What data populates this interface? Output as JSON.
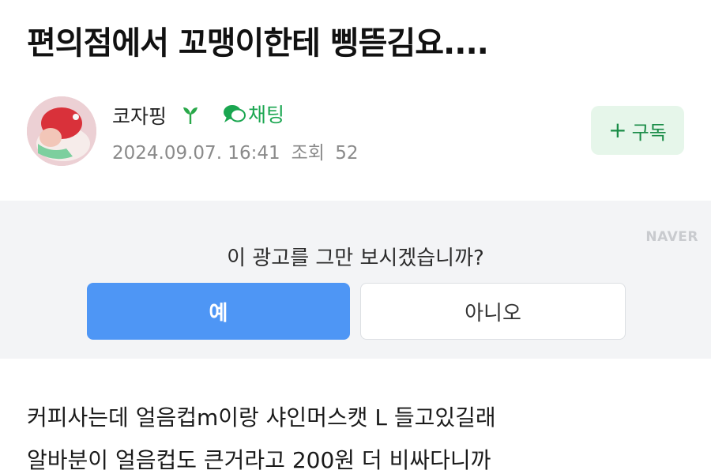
{
  "post": {
    "title": "편의점에서 꼬맹이한테 삥뜯김요....",
    "author": "코자핑",
    "chat_label": "채팅",
    "date": "2024.09.07. 16:41",
    "views_label": "조회",
    "views": "52",
    "subscribe_label": "구독"
  },
  "ad": {
    "brand": "NAVER",
    "question": "이 광고를 그만 보시겠습니까?",
    "yes_label": "예",
    "no_label": "아니오"
  },
  "content": {
    "lines": [
      "커피사는데 얼음컵m이랑 샤인머스캣 L 들고있길래",
      "알바분이 얼음컵도 큰거라고 200원 더 비싸다니까"
    ]
  },
  "icons": {
    "sprout": "sprout-icon",
    "chat": "chat-bubble-icon",
    "plus": "plus-icon"
  },
  "colors": {
    "accent_green": "#1aa650",
    "subscribe_bg": "#e6f6ea",
    "yes_button": "#4e96f5",
    "ad_panel_bg": "#f3f4f6"
  }
}
